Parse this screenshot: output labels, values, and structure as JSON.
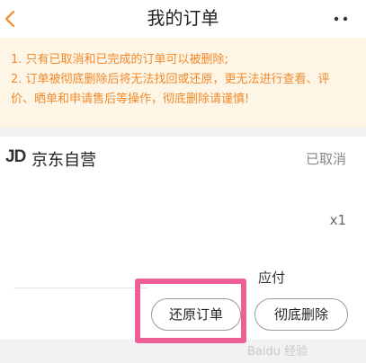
{
  "header": {
    "title": "我的订单",
    "back_icon": "chevron-left-icon",
    "more_icon": "more-dots-icon",
    "accent_color": "#f28a2b"
  },
  "notice": {
    "line1": "1. 只有已取消和已完成的订单可以被删除;",
    "line2": "2. 订单被彻底删除后将无法找回或还原，更无法进行查看、评",
    "line3": "价、晒单和申请售后等操作，彻底删除请谨慎!"
  },
  "order": {
    "logo": "JD",
    "store": "京东自营",
    "status": "已取消",
    "quantity": "x1",
    "payable_label": "应付",
    "restore_label": "还原订单",
    "delete_label": "彻底删除"
  },
  "highlight_color": "#ee5f97",
  "watermark": "Baidu 经验"
}
